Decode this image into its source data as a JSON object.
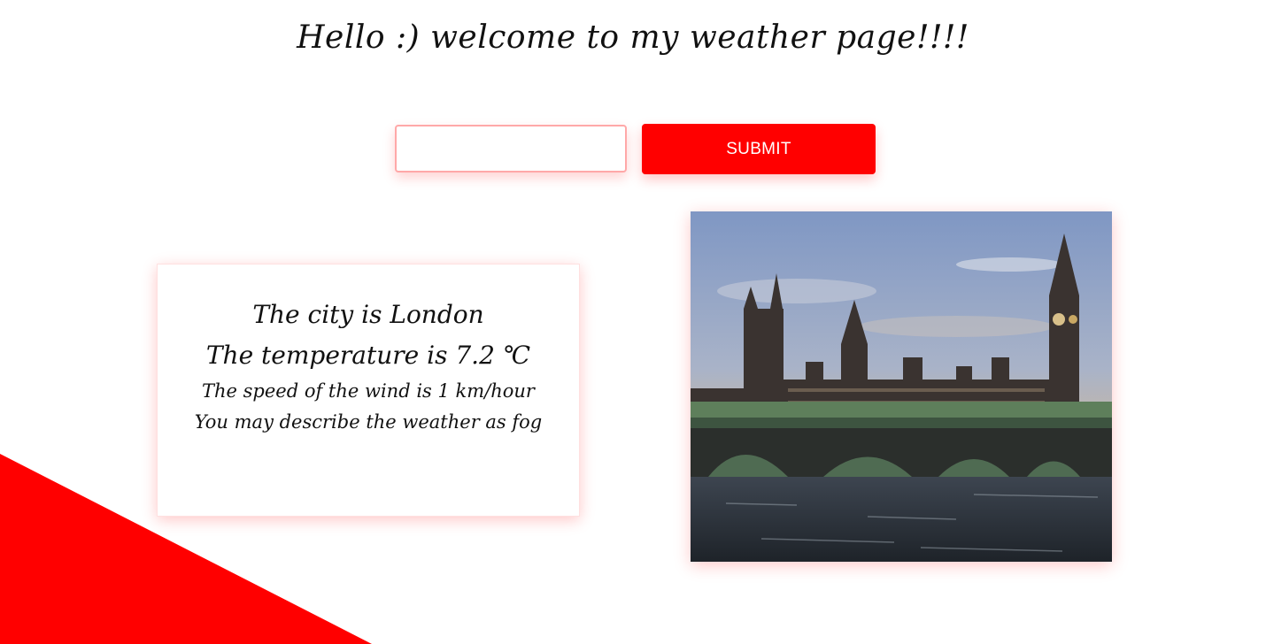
{
  "header": {
    "title": "Hello :) welcome to my weather page!!!!"
  },
  "search": {
    "value": "",
    "placeholder": "",
    "submit_label": "SUBMIT"
  },
  "weather": {
    "city_line": "The city is London",
    "temperature_line": "The temperature is 7.2 ℃",
    "wind_line": "The speed of the wind is 1 km/hour",
    "description_line": "You may describe the weather as fog"
  },
  "colors": {
    "accent": "#ff0000",
    "input_border": "#ffa8a8"
  }
}
